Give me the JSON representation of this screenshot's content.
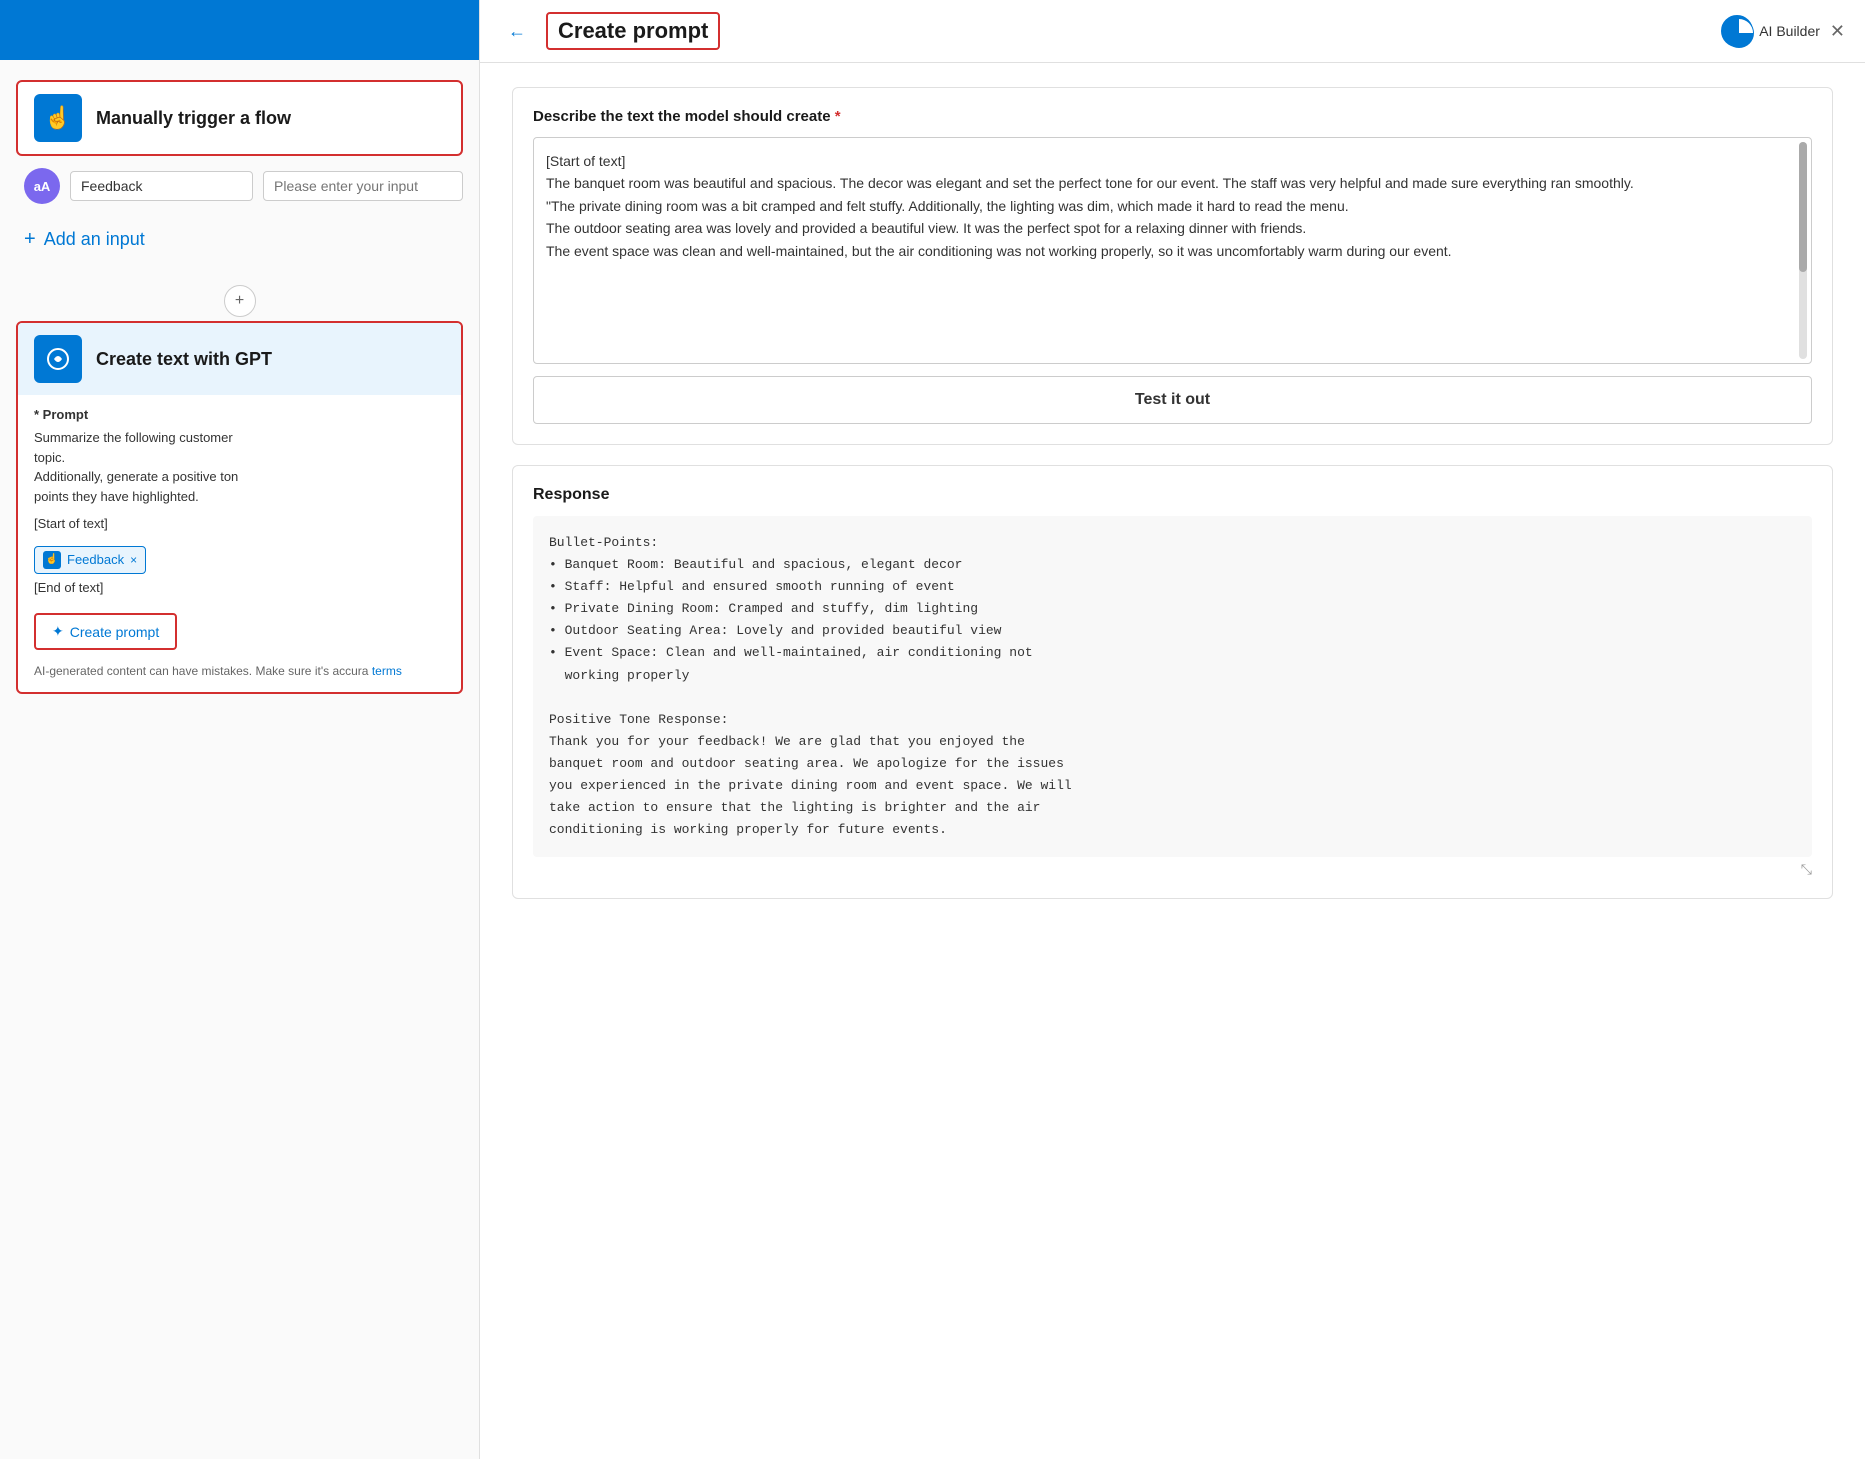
{
  "left": {
    "trigger": {
      "label": "Manually trigger a flow",
      "icon": "☝"
    },
    "input_row": {
      "avatar_initials": "aA",
      "feedback_value": "Feedback",
      "placeholder": "Please enter your input"
    },
    "add_input": {
      "label": "Add an input",
      "plus": "+"
    },
    "gpt_block": {
      "label": "Create text with GPT",
      "icon": "⊕",
      "prompt_prefix": "* Prompt",
      "prompt_lines": [
        "Summarize the following customer",
        "topic.",
        "Additionally, generate a positive ton",
        "points they have highlighted."
      ],
      "start_tag": "[Start of text]",
      "end_tag": "[End of text]",
      "feedback_tag": "Feedback",
      "feedback_tag_close": "×"
    },
    "create_prompt_btn": {
      "label": "Create prompt",
      "icon": "✦"
    },
    "disclaimer": {
      "text": "AI-generated content can have mistakes. Make sure it's accura",
      "link_label": "terms"
    }
  },
  "right": {
    "header": {
      "back_icon": "←",
      "title": "Create prompt",
      "ai_builder_label": "AI Builder",
      "close_icon": "✕"
    },
    "describe_section": {
      "label": "Describe the text the model should create",
      "required": "*",
      "textarea_content": "[Start of text]\nThe banquet room was beautiful and spacious. The decor was elegant and set the perfect tone for our event. The staff was very helpful and made sure everything ran smoothly.\n\"The private dining room was a bit cramped and felt stuffy. Additionally, the lighting was dim, which made it hard to read the menu.\nThe outdoor seating area was lovely and provided a beautiful view. It was the perfect spot for a relaxing dinner with friends.\nThe event space was clean and well-maintained, but the air conditioning was not working properly, so it was uncomfortably warm during our event."
    },
    "test_btn": {
      "label": "Test it out"
    },
    "response_section": {
      "label": "Response",
      "content": "Bullet-Points:\n• Banquet Room: Beautiful and spacious, elegant decor\n• Staff: Helpful and ensured smooth running of event\n• Private Dining Room: Cramped and stuffy, dim lighting\n• Outdoor Seating Area: Lovely and provided beautiful view\n• Event Space: Clean and well-maintained, air conditioning not\n  working properly\n\nPositive Tone Response:\nThank you for your feedback! We are glad that you enjoyed the\nbanquet room and outdoor seating area. We apologize for the issues\nyou experienced in the private dining room and event space. We will\ntake action to ensure that the lighting is brighter and the air\nconditioning is working properly for future events."
    }
  }
}
